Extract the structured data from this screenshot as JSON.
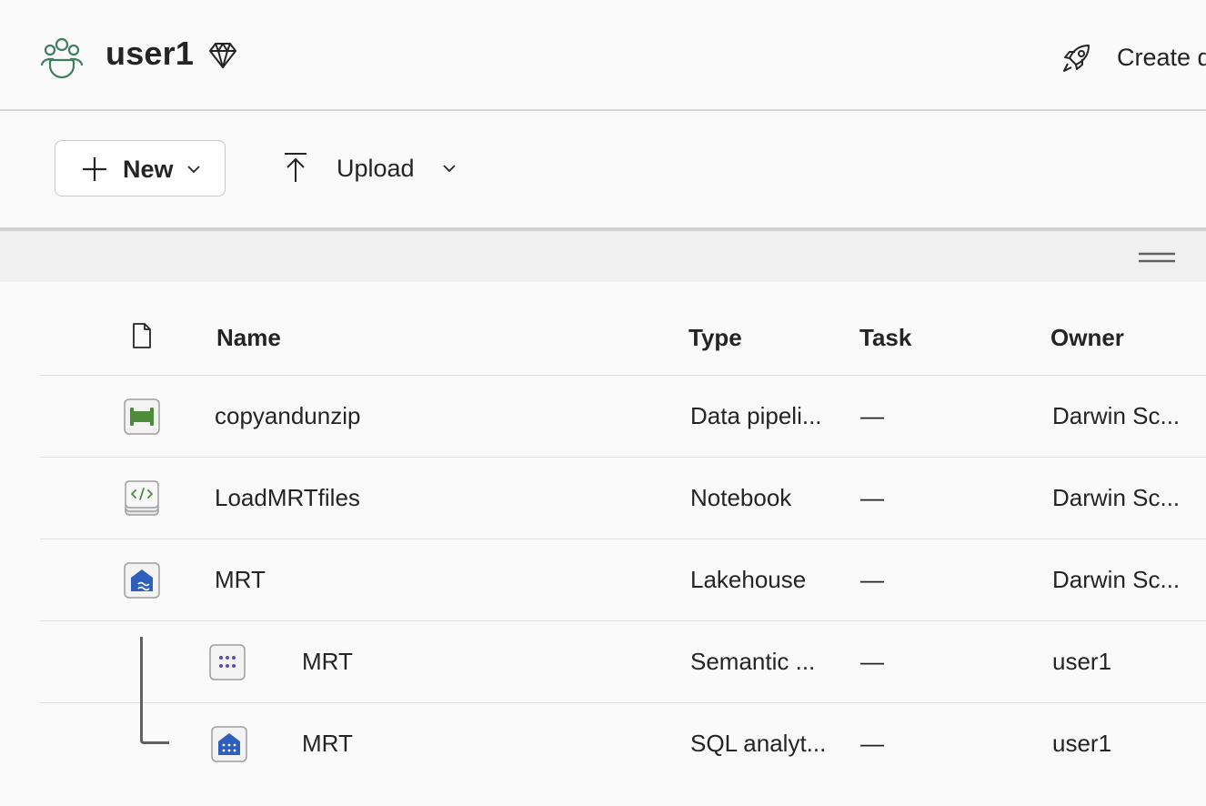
{
  "header": {
    "workspace_name": "user1",
    "workspace_icon": "people-group-icon",
    "premium_icon": "diamond-icon",
    "create_icon": "rocket-icon",
    "create_label": "Create d"
  },
  "toolbar": {
    "new_label": "New",
    "upload_label": "Upload"
  },
  "table": {
    "columns": {
      "name": "Name",
      "type": "Type",
      "task": "Task",
      "owner": "Owner"
    },
    "rows": [
      {
        "name": "copyandunzip",
        "type": "Data pipeli...",
        "task": "—",
        "owner": "Darwin Sc...",
        "icon": "pipeline-icon"
      },
      {
        "name": "LoadMRTfiles",
        "type": "Notebook",
        "task": "—",
        "owner": "Darwin Sc...",
        "icon": "notebook-icon"
      },
      {
        "name": "MRT",
        "type": "Lakehouse",
        "task": "—",
        "owner": "Darwin Sc...",
        "icon": "lakehouse-icon"
      },
      {
        "name": "MRT",
        "type": "Semantic ...",
        "task": "—",
        "owner": "user1",
        "icon": "semantic-model-icon"
      },
      {
        "name": "MRT",
        "type": "SQL analyt...",
        "task": "—",
        "owner": "user1",
        "icon": "sql-endpoint-icon"
      }
    ]
  },
  "colors": {
    "accent_green": "#3f7d5f",
    "pipeline_green": "#4c8c3a",
    "lakehouse_blue": "#2f5fbd",
    "semantic_purple": "#5a4bb0"
  }
}
